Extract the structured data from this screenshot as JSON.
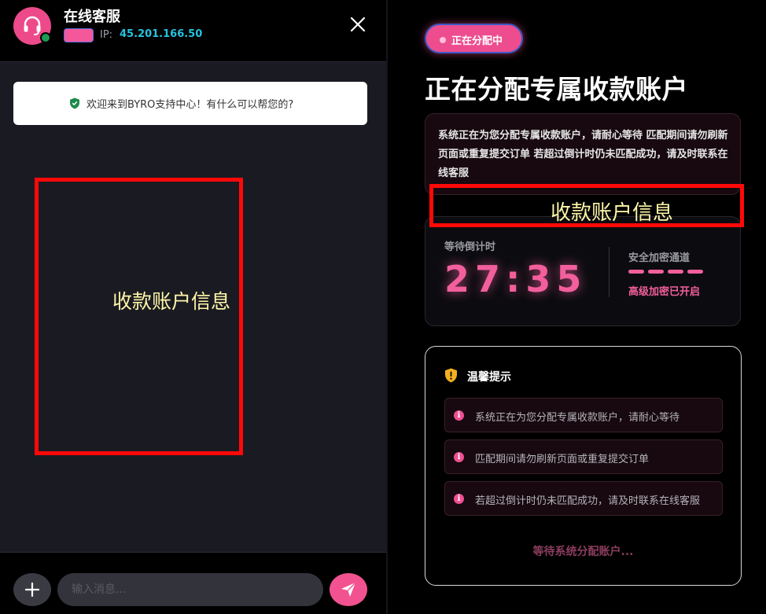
{
  "chat": {
    "agent_name": "在线客服",
    "ip_label": "IP:",
    "ip_value": "45.201.166.50",
    "welcome_message": "欢迎来到BYRO支持中心！有什么可以帮您的?",
    "overlay_label": "收款账户信息",
    "input_placeholder": "输入消息...",
    "icons": {
      "avatar": "headset-icon",
      "close": "close-icon",
      "shield": "shield-icon",
      "add": "plus-icon",
      "send": "send-icon"
    }
  },
  "alloc": {
    "status_pill": "正在分配中",
    "title": "正在分配专属收款账户",
    "info_text": "系统正在为您分配专属收款账户，请耐心等待 匹配期间请勿刷新页面或重复提交订单 若超过倒计时仍未匹配成功，请及时联系在线客服",
    "overlay_label": "收款账户信息",
    "timer_label": "等待倒计时",
    "timer_value": "27:35",
    "secure_label": "安全加密通道",
    "secure_status": "高级加密已开启",
    "tips_title": "温馨提示",
    "tips": [
      "系统正在为您分配专属收款账户，请耐心等待",
      "匹配期间请勿刷新页面或重复提交订单",
      "若超过倒计时仍未匹配成功，请及时联系在线客服"
    ],
    "waiting_text": "等待系统分配账户..."
  },
  "colors": {
    "accent_pink": "#f25f9c",
    "ip_cyan": "#26c3df",
    "online_green": "#1e9a55",
    "redaction_red": "#ff0808"
  }
}
